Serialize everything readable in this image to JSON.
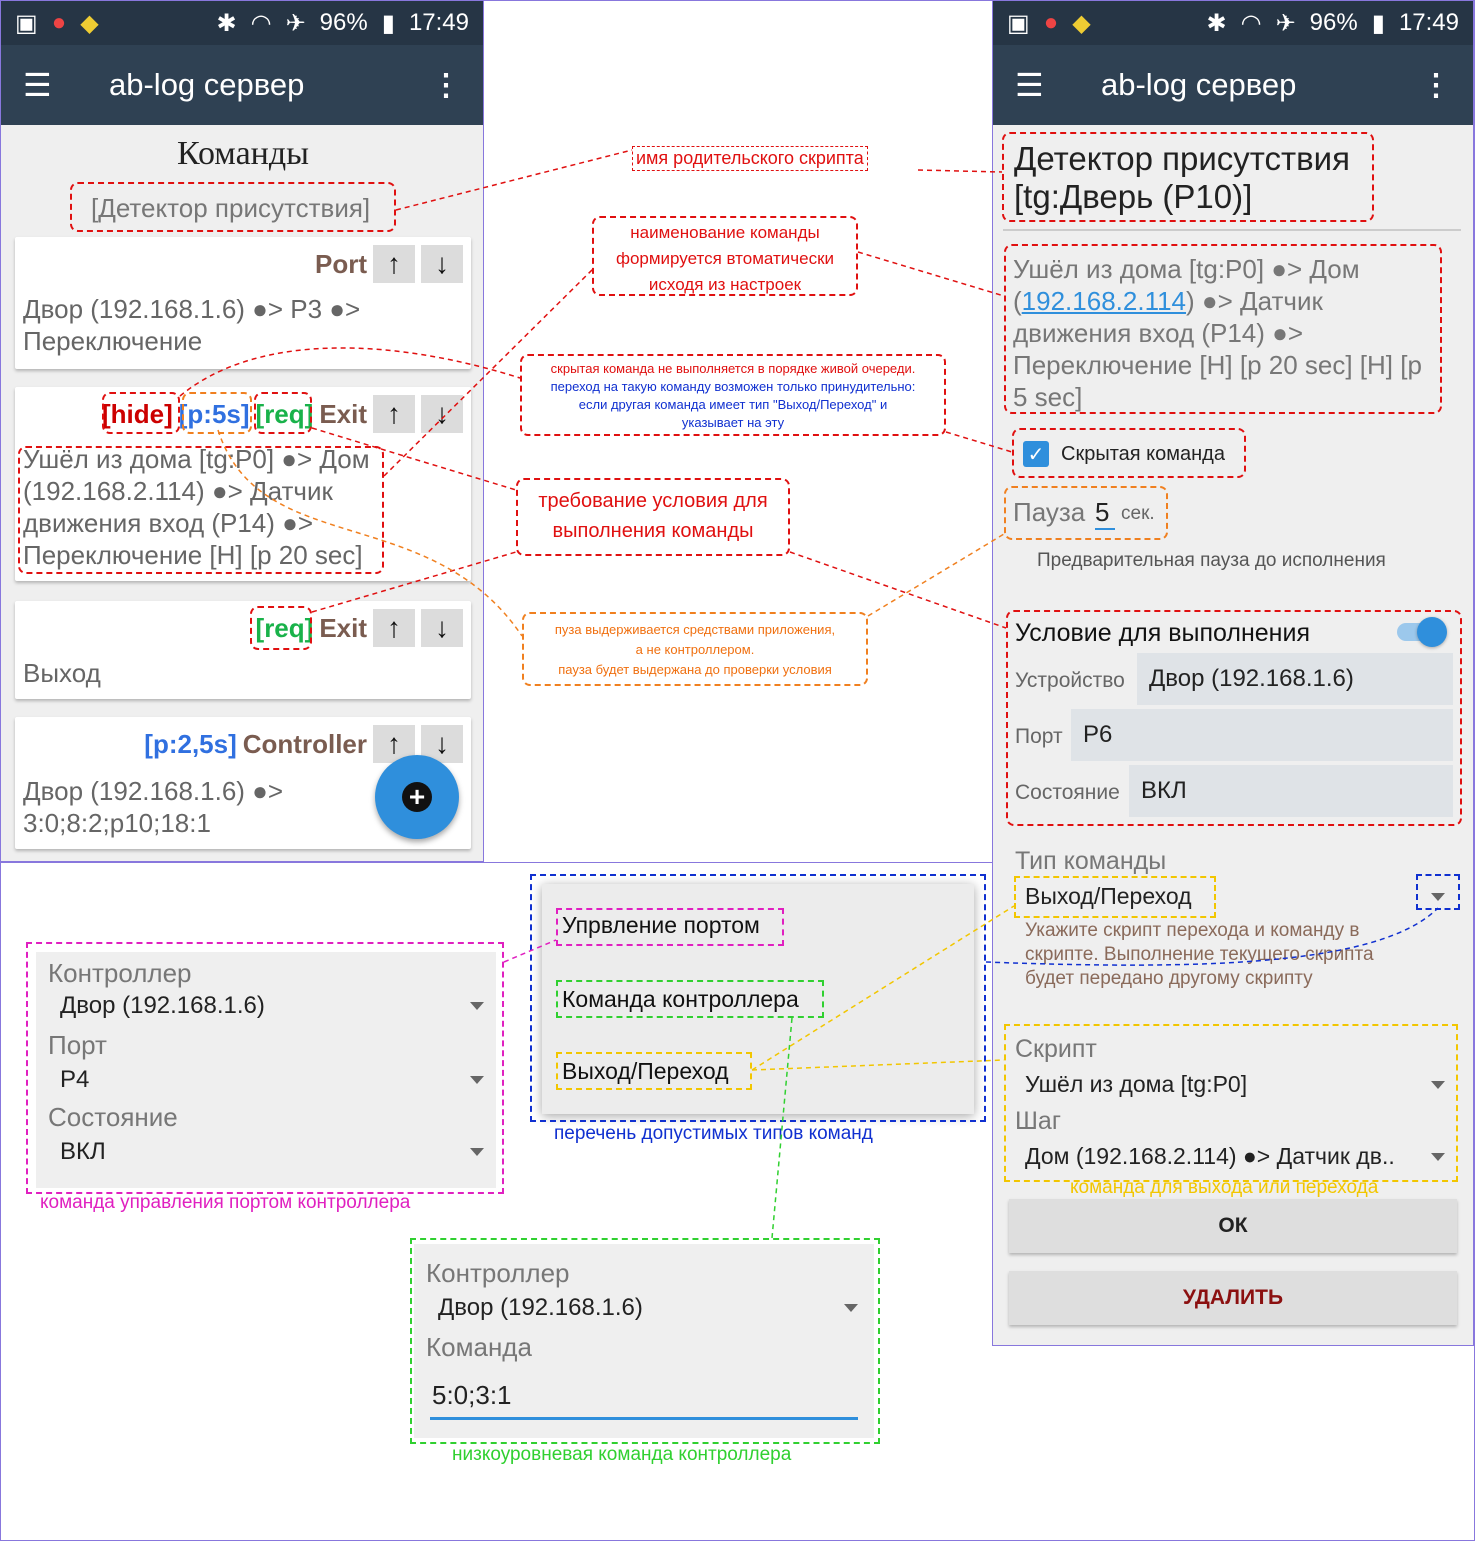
{
  "status": {
    "battery": "96%",
    "time": "17:49"
  },
  "appbar": {
    "title": "ab-log сервер"
  },
  "left": {
    "page_title": "Команды",
    "parent_script": "[Детектор присутствия]",
    "cards": [
      {
        "type": "Port",
        "text": "Двор (192.168.1.6) ●> P3 ●>\nПереключение"
      },
      {
        "tag_hide": "[hide]",
        "tag_pause": "[p:5s]",
        "tag_req": "[req]",
        "type": "Exit",
        "text": "Ушёл из дома [tg:P0] ●> Дом\n(192.168.2.114) ●> Датчик\nдвижения вход (P14) ●>\nПереключение [H] [p 20 sec]"
      },
      {
        "tag_req": "[req]",
        "type": "Exit",
        "text": "Выход"
      },
      {
        "tag_pause": "[p:2,5s]",
        "type": "Controller",
        "text": "Двор (192.168.1.6) ●>\n3:0;8:2;p10;18:1"
      }
    ],
    "fab": "+"
  },
  "right": {
    "script_title": "Детектор присутствия\n[tg:Дверь (P10)]",
    "cmd_pre": "Ушёл из дома [tg:P0] ●> Дом\n(",
    "cmd_link": "192.168.2.114",
    "cmd_post": ") ●> Датчик\nдвижения вход (P14) ●>\nПереключение [H] [p 20 sec] [H] [p\n5 sec]",
    "hidden_label": "Скрытая команда",
    "pause_label": "Пауза",
    "pause_value": "5",
    "pause_unit": "сек.",
    "pause_hint": "Предварительная пауза до исполнения",
    "cond_title": "Условие для выполнения",
    "device_label": "Устройство",
    "device_value": "Двор (192.168.1.6)",
    "port_label": "Порт",
    "port_value": "P6",
    "state_label": "Состояние",
    "state_value": "ВКЛ",
    "type_label": "Тип команды",
    "type_value": "Выход/Переход",
    "type_hint": "Укажите скрипт перехода и команду в\nскрипте. Выполнение текущего скрипта\nбудет передано другому скрипту",
    "script_label": "Скрипт",
    "script_value": "Ушёл из дома [tg:P0]",
    "step_label": "Шаг",
    "step_value": "Дом (192.168.2.114) ●> Датчик дв..",
    "ok": "ОК",
    "delete": "УДАЛИТЬ"
  },
  "port_form": {
    "controller_label": "Контроллер",
    "controller_value": "Двор (192.168.1.6)",
    "port_label": "Порт",
    "port_value": "P4",
    "state_label": "Состояние",
    "state_value": "ВКЛ"
  },
  "types_list": {
    "items": [
      "Упрвление портом",
      "Команда контроллера",
      "Выход/Переход"
    ]
  },
  "ctrl_form": {
    "controller_label": "Контроллер",
    "controller_value": "Двор (192.168.1.6)",
    "command_label": "Команда",
    "command_value": "5:0;3:1"
  },
  "notes": {
    "parent_name": "имя родительского скрипта",
    "auto_name": "наименование команды\nформируется втоматически\nисходя из настроек",
    "hidden_1": "скрытая команда не выполняется в порядке живой очереди.",
    "hidden_2": "переход на такую команду возможен только принудительно:\nесли другая команда имеет тип \"Выход/Переход\" и\nуказывает на эту",
    "condition": "требование условия для\nвыполнения команды",
    "pause": "пуза выдерживается средствами приложения,\nа не контроллером.\nпауза будет выдержана до проверки условия",
    "port_caption": "команда управления портом контроллера",
    "types_caption": "перечень допустимых типов команд",
    "ctrl_caption": "низкоуровневая команда контроллера",
    "exit_caption": "команда для выхода или перехода"
  },
  "colors": {
    "statusbar": "#263545",
    "appbar": "#2f4153",
    "accent": "#2f8fdc"
  }
}
